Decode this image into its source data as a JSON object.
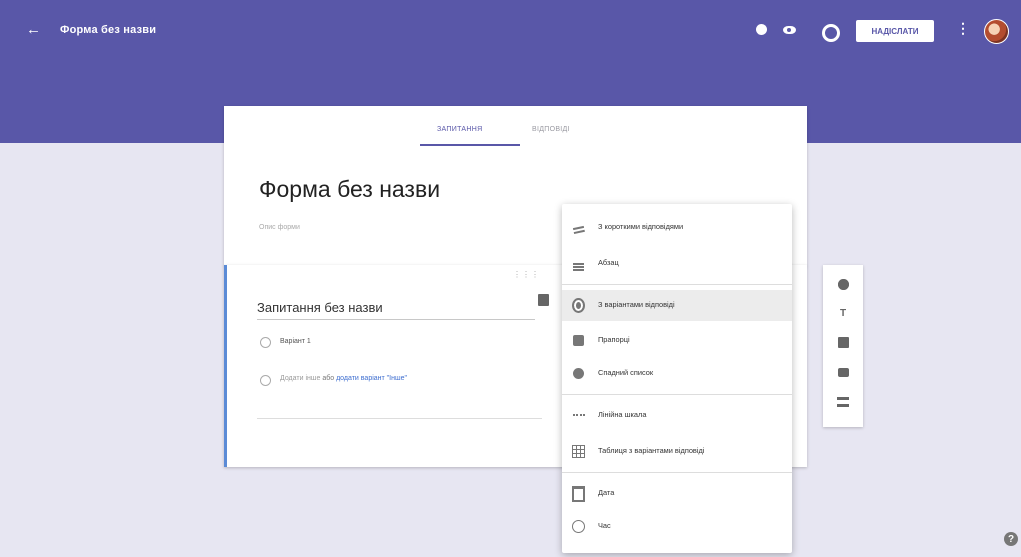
{
  "header": {
    "back_icon": "arrow-left-icon",
    "title": "Форма без назви",
    "icons": [
      "palette-icon",
      "eye-icon",
      "gear-icon",
      "more-vert-icon",
      "avatar"
    ],
    "send_label": "НАДІСЛАТИ",
    "more_label": "⋮"
  },
  "form": {
    "tabs": [
      {
        "label": "Запитання",
        "active": true
      },
      {
        "label": "Відповіді",
        "active": false
      }
    ],
    "title": "Форма без назви",
    "description_placeholder": "Опис форми"
  },
  "question": {
    "title": "Запитання без назви",
    "options": [
      "Варіант 1"
    ],
    "add_option_prefix": "Додати інше",
    "add_option_or": "або",
    "add_option_link": "додати варіант \"Інше\"",
    "drag_dots": "⋮⋮⋮"
  },
  "menu": {
    "items": [
      {
        "label": "З короткими відповідями",
        "icon": "short-answer-icon"
      },
      {
        "label": "Абзац",
        "icon": "paragraph-icon"
      },
      {
        "label": "З варіантами відповіді",
        "icon": "radio-button-icon",
        "active": true
      },
      {
        "label": "Прапорці",
        "icon": "checkbox-icon"
      },
      {
        "label": "Спадний список",
        "icon": "dropdown-icon"
      },
      {
        "label": "Лінійна шкала",
        "icon": "linear-scale-icon"
      },
      {
        "label": "Таблиця з варіантами відповіді",
        "icon": "grid-icon"
      },
      {
        "label": "Дата",
        "icon": "calendar-icon"
      },
      {
        "label": "Час",
        "icon": "clock-icon"
      }
    ]
  },
  "toolbar": {
    "tools": [
      "add-question-icon",
      "title-text-icon",
      "add-image-icon",
      "add-video-icon",
      "add-section-icon"
    ]
  },
  "help_label": "?"
}
